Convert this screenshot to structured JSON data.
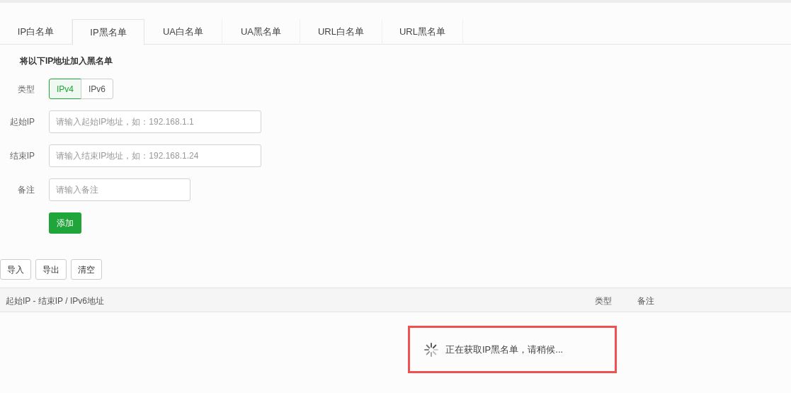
{
  "tabs": [
    {
      "label": "IP白名单",
      "selected": false
    },
    {
      "label": "IP黑名单",
      "selected": true
    },
    {
      "label": "UA白名单",
      "selected": false
    },
    {
      "label": "UA黑名单",
      "selected": false
    },
    {
      "label": "URL白名单",
      "selected": false
    },
    {
      "label": "URL黑名单",
      "selected": false
    }
  ],
  "form": {
    "heading": "将以下IP地址加入黑名单",
    "type": {
      "label": "类型",
      "options": [
        {
          "label": "IPv4",
          "selected": true
        },
        {
          "label": "IPv6",
          "selected": false
        }
      ]
    },
    "fields": [
      {
        "label": "起始IP",
        "placeholder": "请输入起始IP地址，如：192.168.1.1",
        "kind": "address"
      },
      {
        "label": "结束IP",
        "placeholder": "请输入结束IP地址，如：192.168.1.24",
        "kind": "address"
      },
      {
        "label": "备注",
        "placeholder": "请输入备注",
        "kind": "note"
      }
    ],
    "submit": "添加"
  },
  "toolbar": [
    "导入",
    "导出",
    "清空"
  ],
  "table": {
    "columns": [
      "起始IP - 结束IP / IPv6地址",
      "类型",
      "备注"
    ],
    "loading": {
      "text": "正在获取IP黑名单，请稍候...",
      "highlighted": true
    }
  }
}
